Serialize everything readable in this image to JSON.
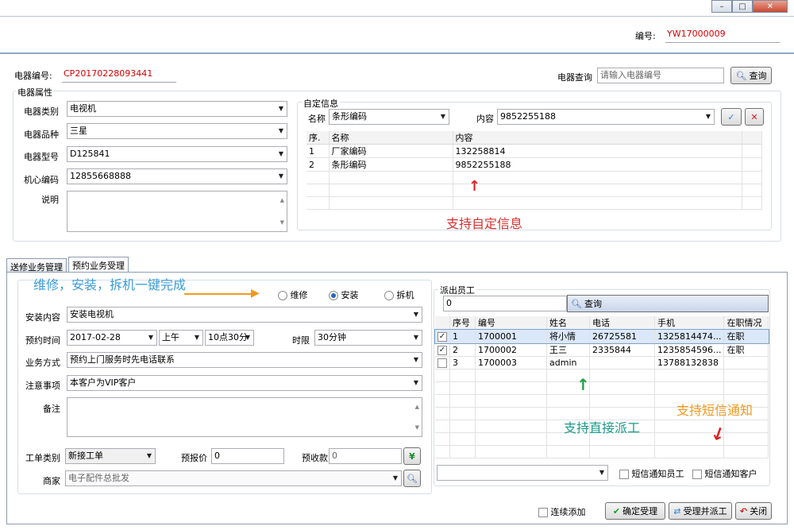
{
  "window": {
    "min": "–",
    "max": "□",
    "close": "✕"
  },
  "header": {
    "code_label": "编号:",
    "code_value": "YW17000009"
  },
  "device": {
    "number_label": "电器编号:",
    "number_value": "CP20170228093441",
    "query_label": "电器查询",
    "query_placeholder": "请输入电器编号",
    "query_button": "查询",
    "attr_group": "电器属性",
    "category_label": "电器类别",
    "category_value": "电视机",
    "brand_label": "电器品种",
    "brand_value": "三星",
    "model_label": "电器型号",
    "model_value": "D125841",
    "core_label": "机心编码",
    "core_value": "12855668888",
    "desc_label": "说明"
  },
  "custom": {
    "group": "自定信息",
    "name_label": "名称",
    "name_value": "条形编码",
    "content_label": "内容",
    "content_value": "9852255188",
    "columns": [
      "序.",
      "名称",
      "内容"
    ],
    "rows": [
      {
        "no": "1",
        "name": "厂家编码",
        "content": "132258814"
      },
      {
        "no": "2",
        "name": "条形编码",
        "content": "9852255188"
      }
    ]
  },
  "tabs": [
    "送修业务管理",
    "预约业务受理"
  ],
  "service": {
    "types": [
      "维修",
      "安装",
      "拆机"
    ],
    "selected": "安装",
    "content_label": "安装内容",
    "content_value": "安装电视机",
    "time_label": "预约时间",
    "date_value": "2017-02-28",
    "period_value": "上午",
    "hour_value": "10点30分",
    "limit_label": "时限",
    "limit_value": "30分钟",
    "method_label": "业务方式",
    "method_value": "预约上门服务时先电话联系",
    "notice_label": "注意事项",
    "notice_value": "本客户为VIP客户",
    "remark_label": "备注",
    "order_type_label": "工单类别",
    "order_type_value": "新接工单",
    "quote_label": "预报价",
    "quote_value": "0",
    "prepay_label": "预收款",
    "prepay_value": "0",
    "merchant_label": "商家",
    "merchant_value": "电子配件总批发"
  },
  "staff": {
    "group": "派出员工",
    "search_value": "0",
    "search_button": "查询",
    "columns": [
      "序号",
      "编号",
      "姓名",
      "电话",
      "手机",
      "在职情况"
    ],
    "rows": [
      {
        "checked": true,
        "no": "1",
        "code": "1700001",
        "name": "将小情",
        "phone": "26725581",
        "mobile": "1325814474...",
        "status": "在职"
      },
      {
        "checked": true,
        "no": "2",
        "code": "1700002",
        "name": "王三",
        "phone": "2335844",
        "mobile": "1235854596...",
        "status": "在职"
      },
      {
        "checked": false,
        "no": "3",
        "code": "1700003",
        "name": "admin",
        "phone": "",
        "mobile": "13788132838",
        "status": ""
      }
    ],
    "sms_staff": "短信通知员工",
    "sms_customer": "短信通知客户"
  },
  "footer": {
    "continuous": "连续添加",
    "confirm": "确定受理",
    "dispatch": "受理并派工",
    "close": "关闭"
  },
  "annotations": {
    "custom_info": "支持自定信息",
    "one_click": "维修，安装，拆机一键完成",
    "direct_dispatch": "支持直接派工",
    "sms": "支持短信通知"
  },
  "colors": {
    "red_text": "#d40000",
    "anno_red": "#d43030",
    "anno_blue": "#3a9bd8",
    "anno_teal": "#1a9a8a",
    "anno_orange": "#f09a20",
    "selected_row": "#dbe8fb"
  }
}
